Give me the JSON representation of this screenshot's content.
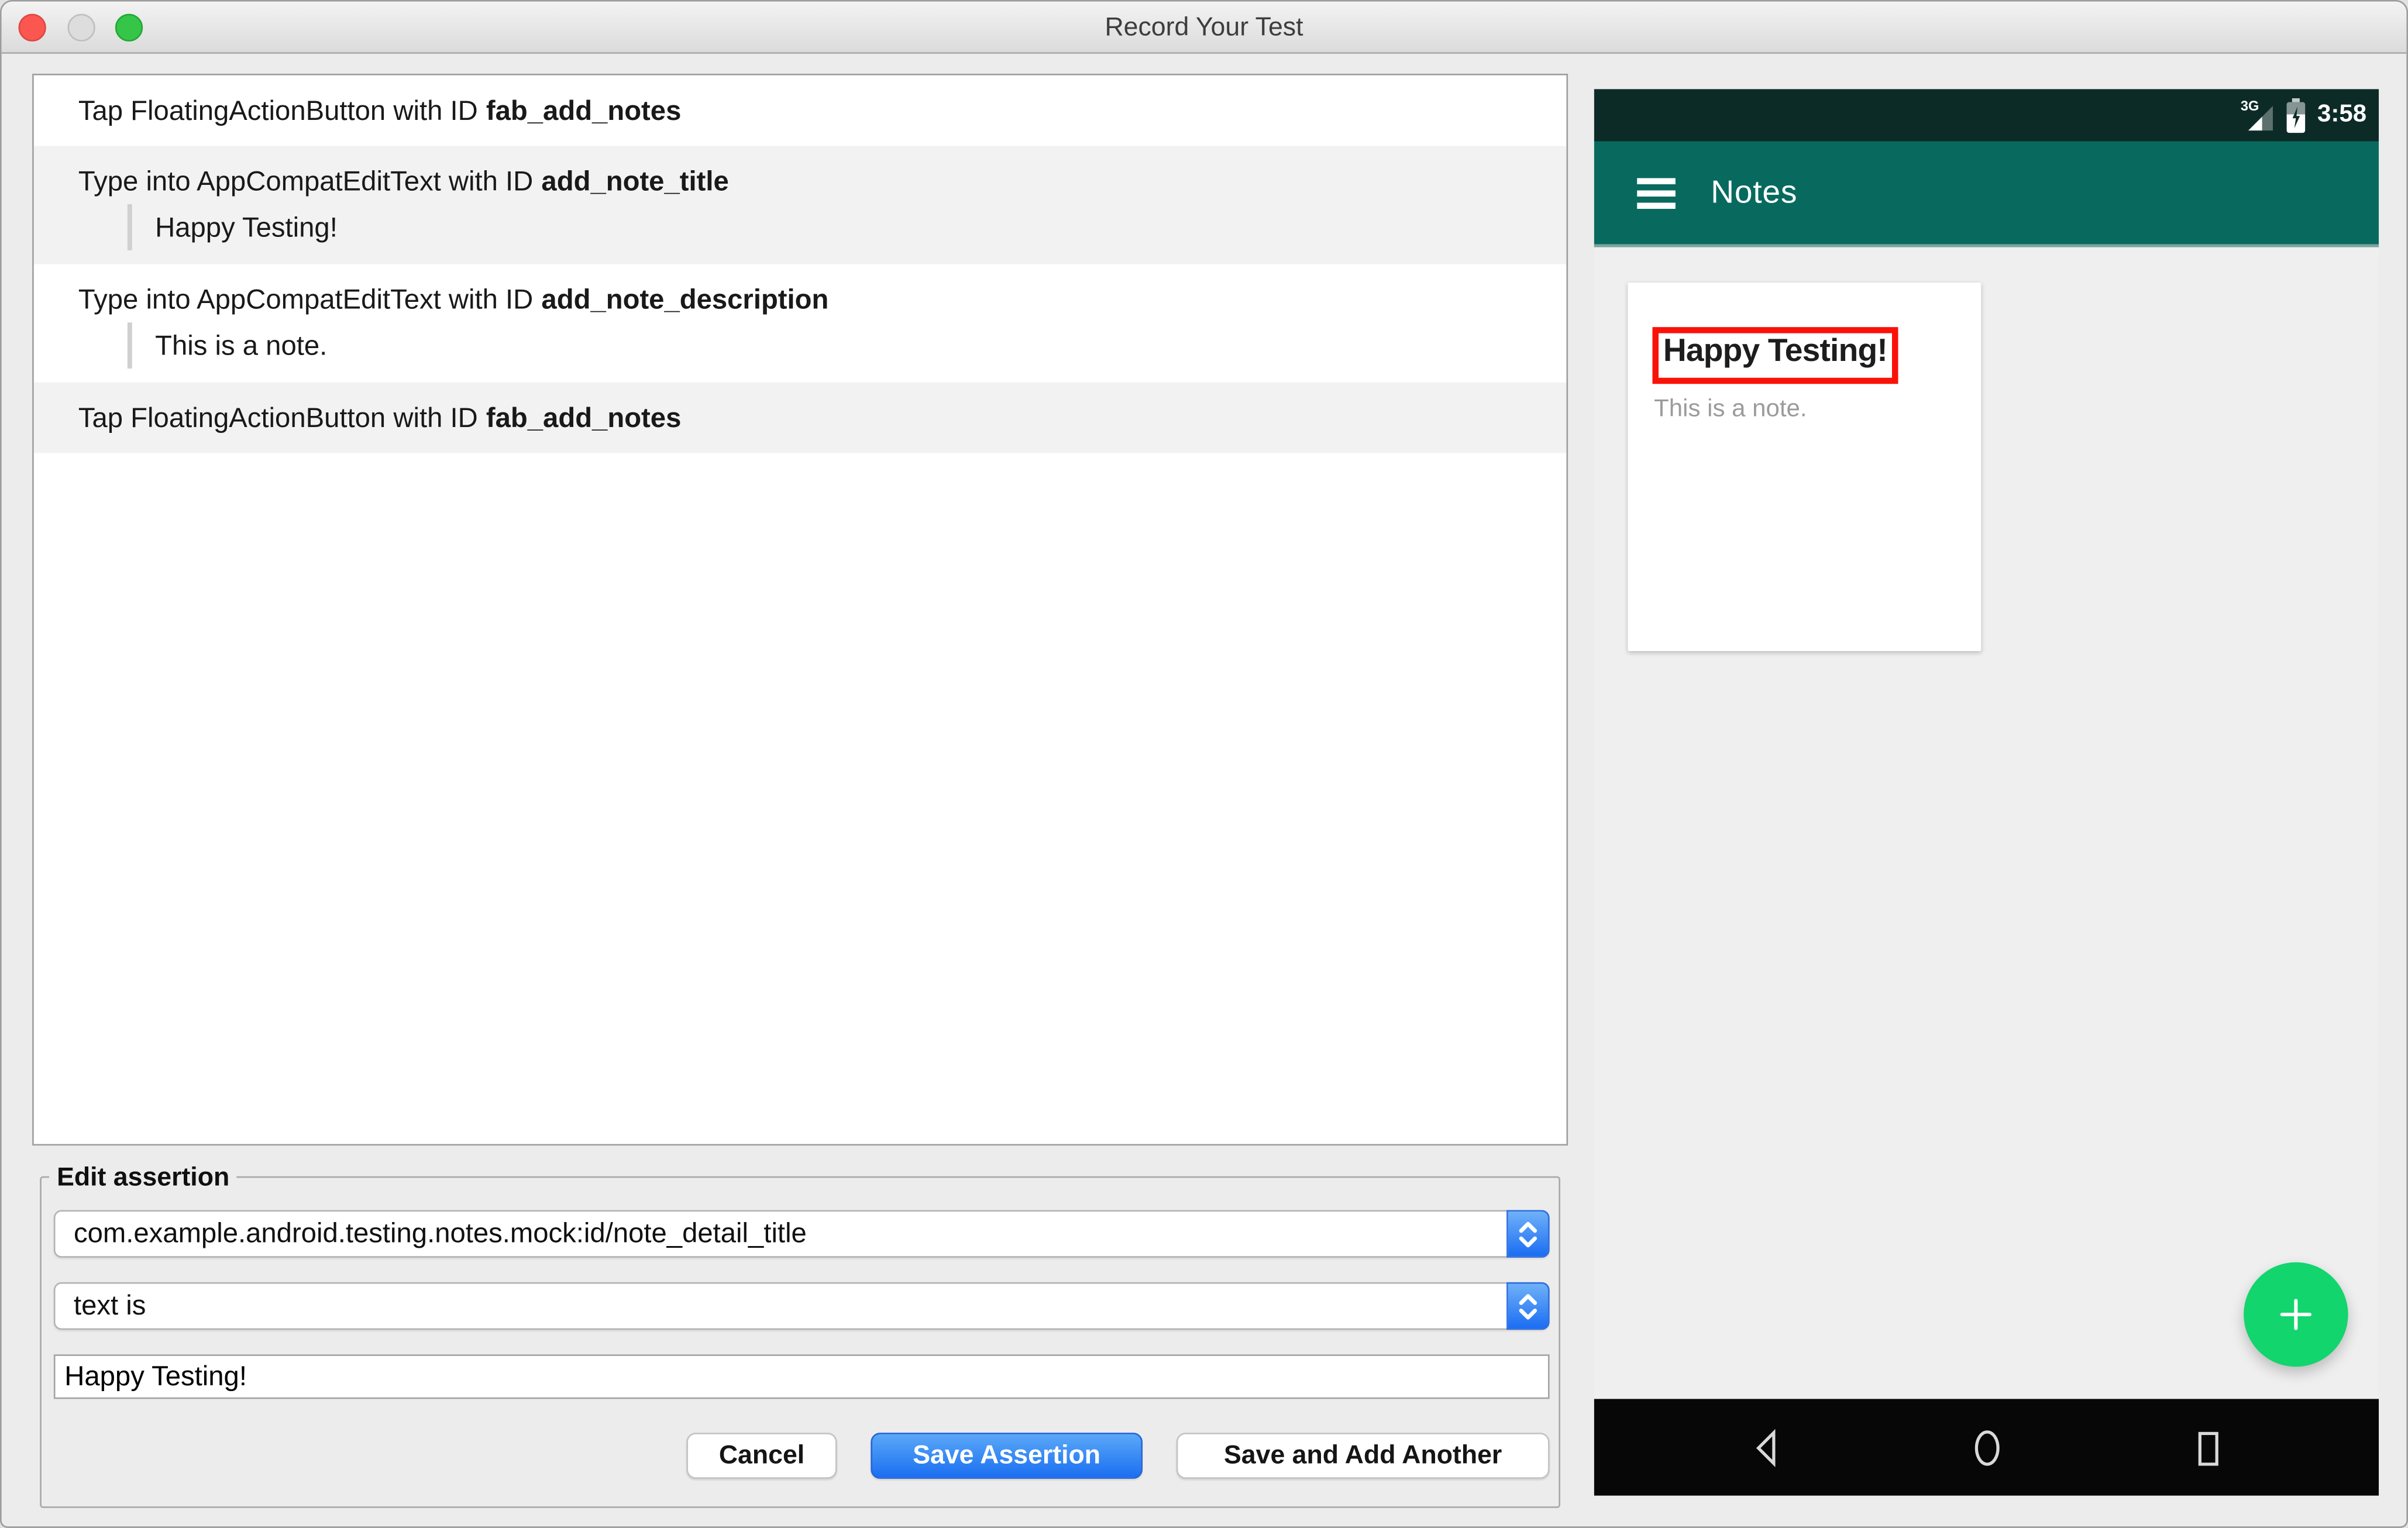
{
  "window": {
    "title": "Record Your Test"
  },
  "action_list": {
    "items": [
      {
        "action": "Tap FloatingActionButton with ID",
        "target_id": "fab_add_notes"
      },
      {
        "action": "Type into AppCompatEditText with ID",
        "target_id": "add_note_title",
        "typed_value": "Happy Testing!"
      },
      {
        "action": "Type into AppCompatEditText with ID",
        "target_id": "add_note_description",
        "typed_value": "This is a note."
      },
      {
        "action": "Tap FloatingActionButton with ID",
        "target_id": "fab_add_notes"
      }
    ]
  },
  "assertion_editor": {
    "legend": "Edit assertion",
    "element_select": {
      "value": "com.example.android.testing.notes.mock:id/note_detail_title"
    },
    "condition_select": {
      "value": "text is"
    },
    "value_input": {
      "value": "Happy Testing!"
    },
    "buttons": {
      "cancel": "Cancel",
      "save": "Save Assertion",
      "save_and_add": "Save and Add Another"
    }
  },
  "device": {
    "status_bar": {
      "network": "3G",
      "time": "3:58"
    },
    "app_bar": {
      "title": "Notes",
      "menu_icon": "hamburger"
    },
    "note_card": {
      "title": "Happy Testing!",
      "description": "This is a note."
    },
    "fab": {
      "icon": "plus"
    },
    "nav_bar": {
      "icons": [
        "back",
        "home",
        "recents"
      ]
    },
    "colors": {
      "status_bar": "#0c2b27",
      "app_bar": "#086a5e",
      "fab_green": "#12d56d",
      "highlight_red": "#fa1208",
      "nav_bar": "#070707"
    }
  },
  "colors": {
    "accent_blue": "#1b6df2",
    "window_bg": "#ececec"
  }
}
